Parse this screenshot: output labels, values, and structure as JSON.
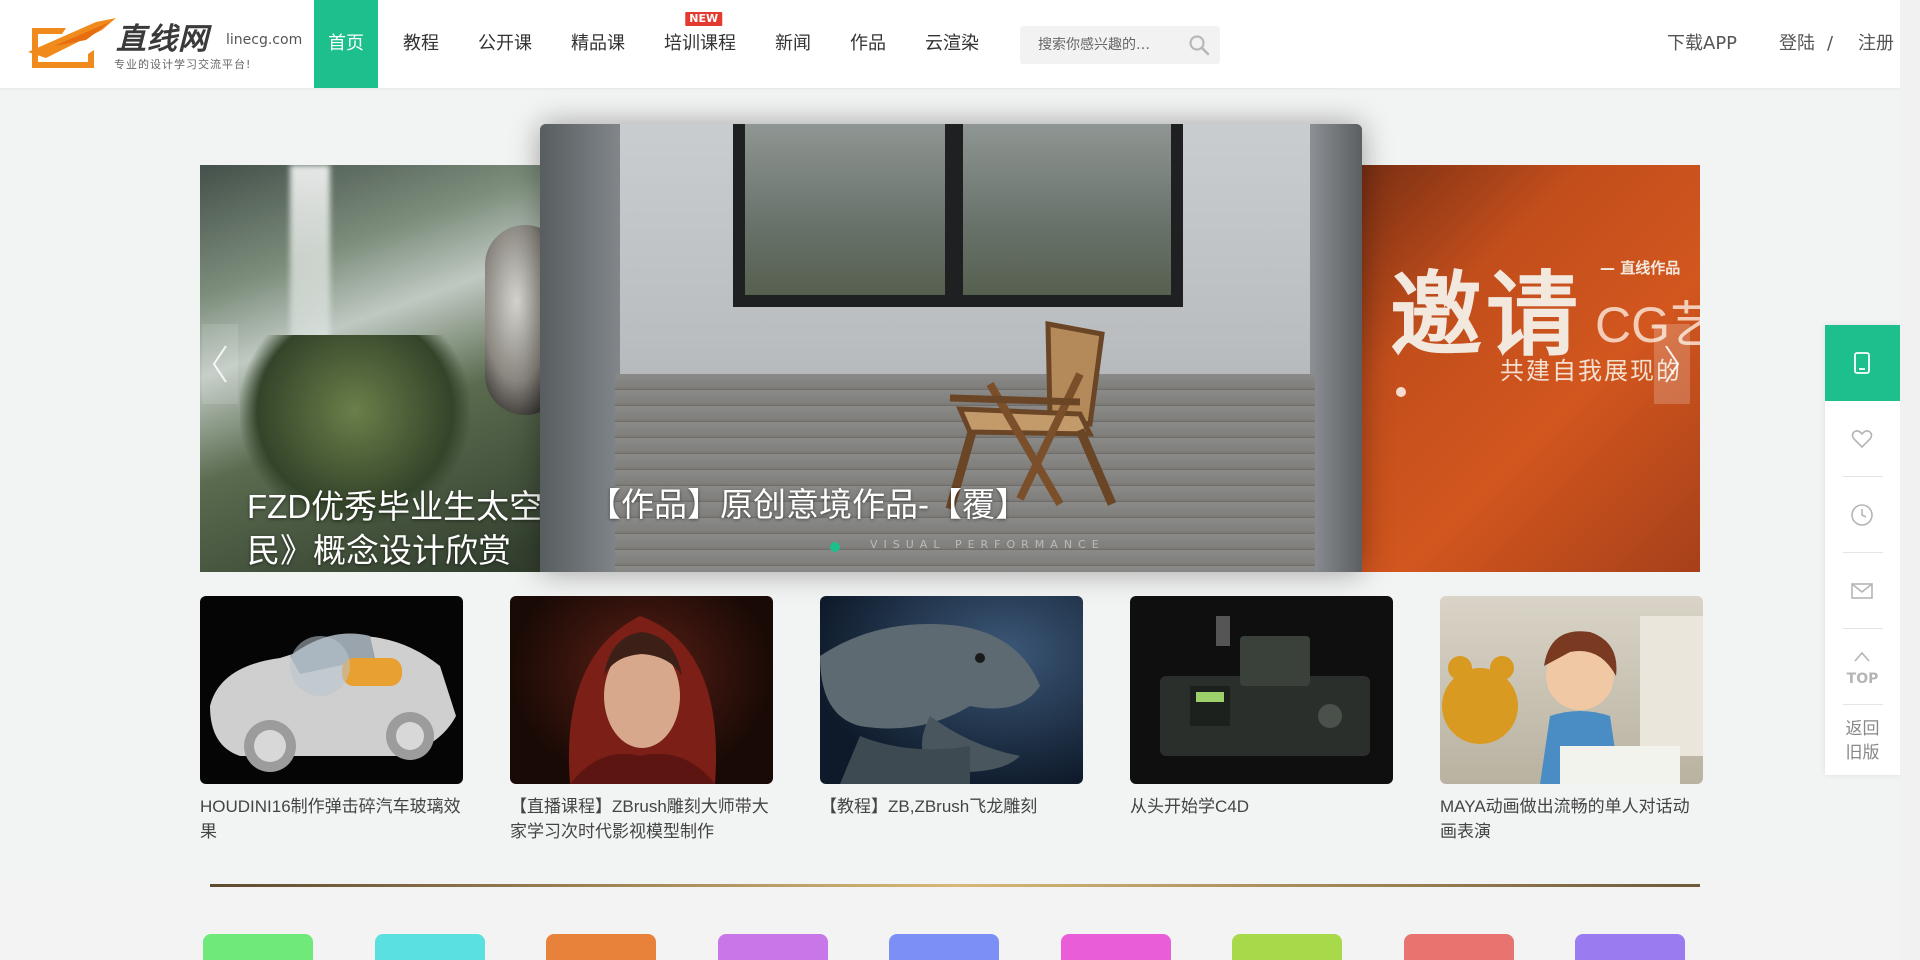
{
  "brand": {
    "name_cn": "直线网",
    "domain": "linecg.com",
    "slogan": "专业的设计学习交流平台!"
  },
  "nav": {
    "items": [
      {
        "label": "首页",
        "active": true
      },
      {
        "label": "教程"
      },
      {
        "label": "公开课"
      },
      {
        "label": "精品课"
      },
      {
        "label": "培训课程",
        "badge": "NEW"
      },
      {
        "label": "新闻"
      },
      {
        "label": "作品"
      },
      {
        "label": "云渲染"
      }
    ]
  },
  "search": {
    "placeholder": "搜索你感兴趣的…"
  },
  "header_right": {
    "download": "下载APP",
    "login": "登陆",
    "separator": "/",
    "register": "注册"
  },
  "carousel": {
    "left_caption": "FZD优秀毕业生太空移民》概念设计欣赏",
    "left_caption_line1": "FZD优秀毕业生太空",
    "left_caption_line2": "民》概念设计欣赏",
    "main_caption": "【作品】原创意境作品-【覆】",
    "main_watermark": "VISUAL PERFORMANCE",
    "right_text": {
      "big": "邀请",
      "cg": "CG艺",
      "tag": "— 直线作品",
      "sub": "共建自我展现的"
    },
    "active_dot_color": "#1dbf8c"
  },
  "thumbnails": [
    {
      "title": "HOUDINI16制作弹击碎汽车玻璃效果"
    },
    {
      "title": "【直播课程】ZBrush雕刻大师带大家学习次时代影视模型制作"
    },
    {
      "title": "【教程】ZB,ZBrush飞龙雕刻"
    },
    {
      "title": "从头开始学C4D"
    },
    {
      "title": "MAYA动画做出流畅的单人对话动画表演"
    }
  ],
  "sidebar": {
    "items": [
      "tablet-icon",
      "heart-icon",
      "clock-icon",
      "mail-icon",
      "top-icon"
    ],
    "top_label": "TOP",
    "old_version_line1": "返回",
    "old_version_line2": "旧版"
  },
  "colors": {
    "accent": "#1dbf8c",
    "badge": "#e53a2f",
    "tiles": [
      "#6ee97a",
      "#5be0e0",
      "#e8823a",
      "#c977e8",
      "#7b8ff7",
      "#e95ed8",
      "#a7d94a",
      "#e87470",
      "#9b7bf0"
    ]
  }
}
